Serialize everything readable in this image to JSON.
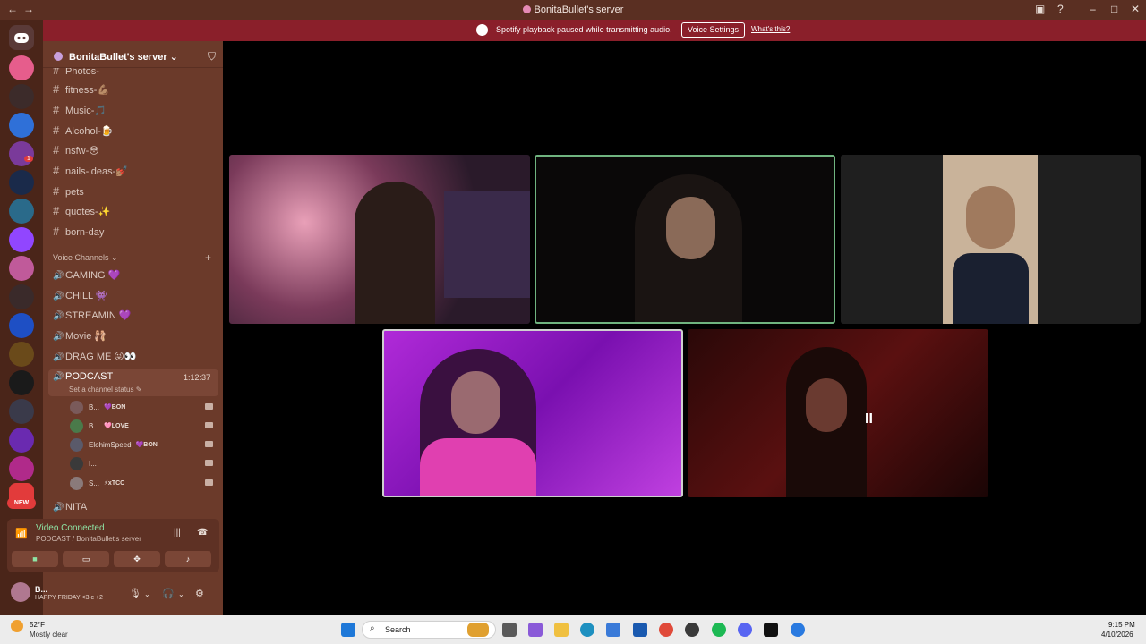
{
  "window": {
    "title": "BonitaBullet's server"
  },
  "banner": {
    "message": "Spotify playback paused while transmitting audio.",
    "button": "Voice Settings",
    "link": "What's this?"
  },
  "server": {
    "name": "BonitaBullet's server"
  },
  "text_channels": [
    {
      "name": "Photos-"
    },
    {
      "name": "fitness-💪🏽"
    },
    {
      "name": "Music-🎵"
    },
    {
      "name": "Alcohol-🍺"
    },
    {
      "name": "nsfw-😳"
    },
    {
      "name": "nails-ideas-💅🏽"
    },
    {
      "name": "pets"
    },
    {
      "name": "quotes-✨"
    },
    {
      "name": "born-day"
    }
  ],
  "voice_section": {
    "label": "Voice Channels"
  },
  "voice_channels": [
    {
      "name": "GAMING 💜"
    },
    {
      "name": "CHILL 👾"
    },
    {
      "name": "STREAMIN 💜"
    },
    {
      "name": "Movie 🩰"
    },
    {
      "name": "DRAG ME 😜👀"
    }
  ],
  "podcast": {
    "name": "PODCAST",
    "time": "1:12:37",
    "status": "Set a channel status"
  },
  "podcast_users": [
    {
      "name": "B...",
      "tag": "💜BON"
    },
    {
      "name": "B...",
      "tag": "🩷LOVE"
    },
    {
      "name": "ElohimSpeed",
      "tag": "💜BON"
    },
    {
      "name": "I...",
      "tag": ""
    },
    {
      "name": "S...",
      "tag": "⚡xTCC"
    }
  ],
  "after_channel": {
    "name": "NITA"
  },
  "voice_status": {
    "title": "Video Connected",
    "subtitle": "PODCAST / BonitaBullet's server"
  },
  "user": {
    "name": "B...",
    "status": "HAPPY FRIDAY <3 c +2"
  },
  "guild_new_badge": "NEW",
  "guild_badge_count": "1",
  "taskbar": {
    "temp": "52°F",
    "condition": "Mostly clear",
    "search": "Search",
    "time": "9:15 PM",
    "date": "4/10/2026"
  },
  "colors": {
    "titlebar": "#5a2f22",
    "sidebar": "#6b3a2a",
    "guildbar": "#4a2519",
    "banner": "#8a1f2a",
    "connected_green": "#8ee3a4",
    "speaking_border": "#6fb37f"
  }
}
